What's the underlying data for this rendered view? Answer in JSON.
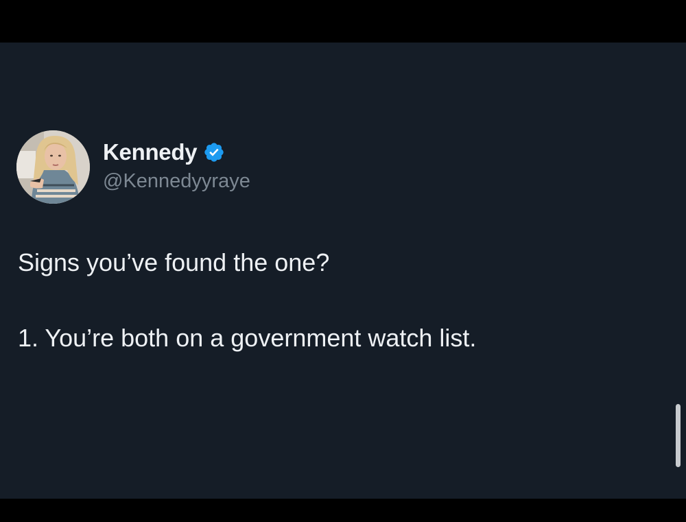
{
  "tweet": {
    "author": {
      "display_name": "Kennedy",
      "handle": "@Kennedyyraye",
      "verified": true,
      "verified_icon": "verified-badge-icon"
    },
    "text_lines": [
      "Signs you’ve found the one?",
      "1. You’re both on a government watch list."
    ]
  },
  "colors": {
    "background": "#151d27",
    "letterbox": "#000000",
    "text_primary": "#eef1f4",
    "text_secondary": "#7d8893",
    "verified_blue": "#1d9bf0",
    "scrollbar": "#c8cbcf"
  }
}
